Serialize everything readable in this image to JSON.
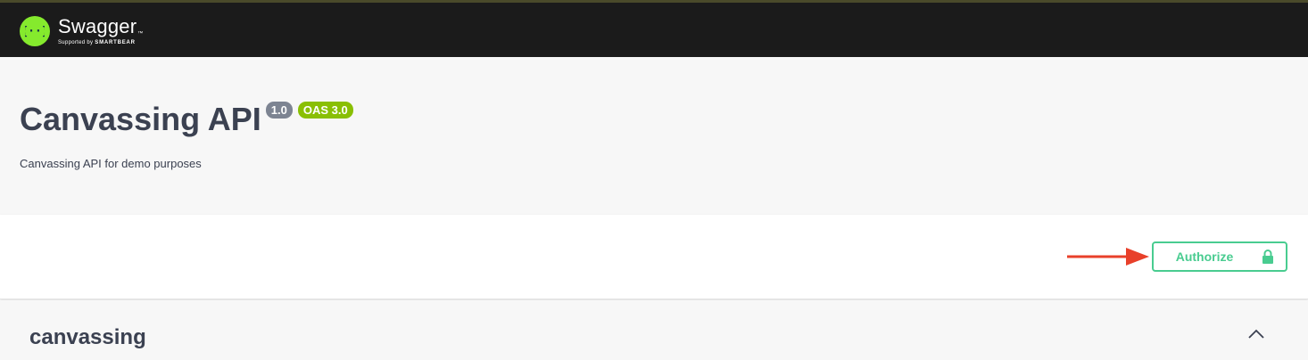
{
  "topbar": {
    "logo_name": "Swagger",
    "logo_tm": "™",
    "logo_sub_prefix": "Supported by ",
    "logo_sub_brand": "SMARTBEAR",
    "logo_icon": "swagger-braces-icon",
    "logo_color": "#85ea2d"
  },
  "info": {
    "title": "Canvassing API",
    "version": "1.0",
    "oas_version": "OAS 3.0",
    "description": "Canvassing API for demo purposes"
  },
  "scheme": {
    "authorize_label": "Authorize",
    "lock_icon": "lock-icon",
    "arrow_icon": "red-arrow-right-icon",
    "authorize_color": "#49cc90",
    "arrow_color": "#e8402a"
  },
  "tags": [
    {
      "name": "canvassing",
      "expanded": true,
      "toggle_icon": "chevron-up-icon"
    }
  ]
}
